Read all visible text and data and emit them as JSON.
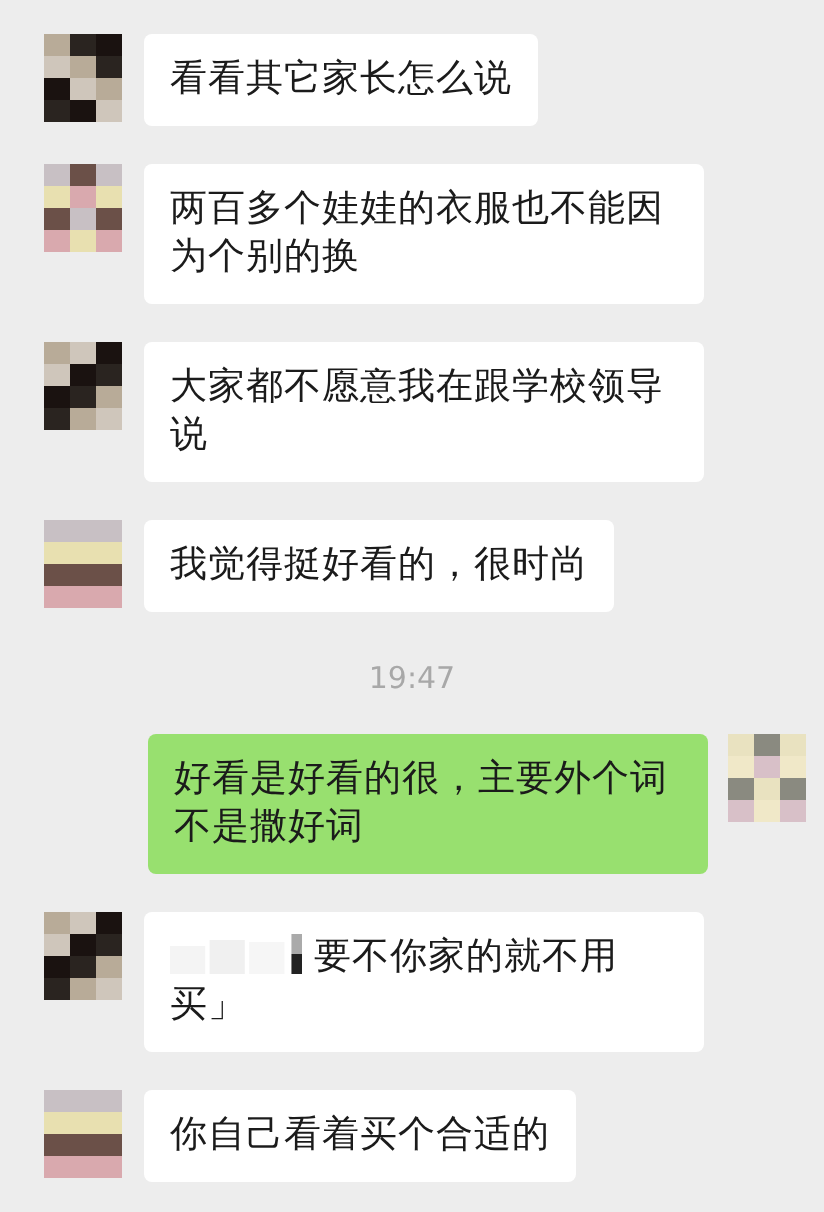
{
  "messages": [
    {
      "kind": "message",
      "outgoing": false,
      "text": "看看其它家长怎么说"
    },
    {
      "kind": "message",
      "outgoing": false,
      "text": "两百多个娃娃的衣服也不能因为个别的换"
    },
    {
      "kind": "message",
      "outgoing": false,
      "text": "大家都不愿意我在跟学校领导说"
    },
    {
      "kind": "message",
      "outgoing": false,
      "text": "我觉得挺好看的，很时尚"
    },
    {
      "kind": "time",
      "text": "19:47"
    },
    {
      "kind": "message",
      "outgoing": true,
      "text": "好看是好看的很，主要外个词不是撒好词"
    },
    {
      "kind": "message",
      "outgoing": false,
      "redacted": true,
      "text": "要不你家的就不用买」"
    },
    {
      "kind": "message",
      "outgoing": false,
      "text": "你自己看着买个合适的"
    }
  ]
}
